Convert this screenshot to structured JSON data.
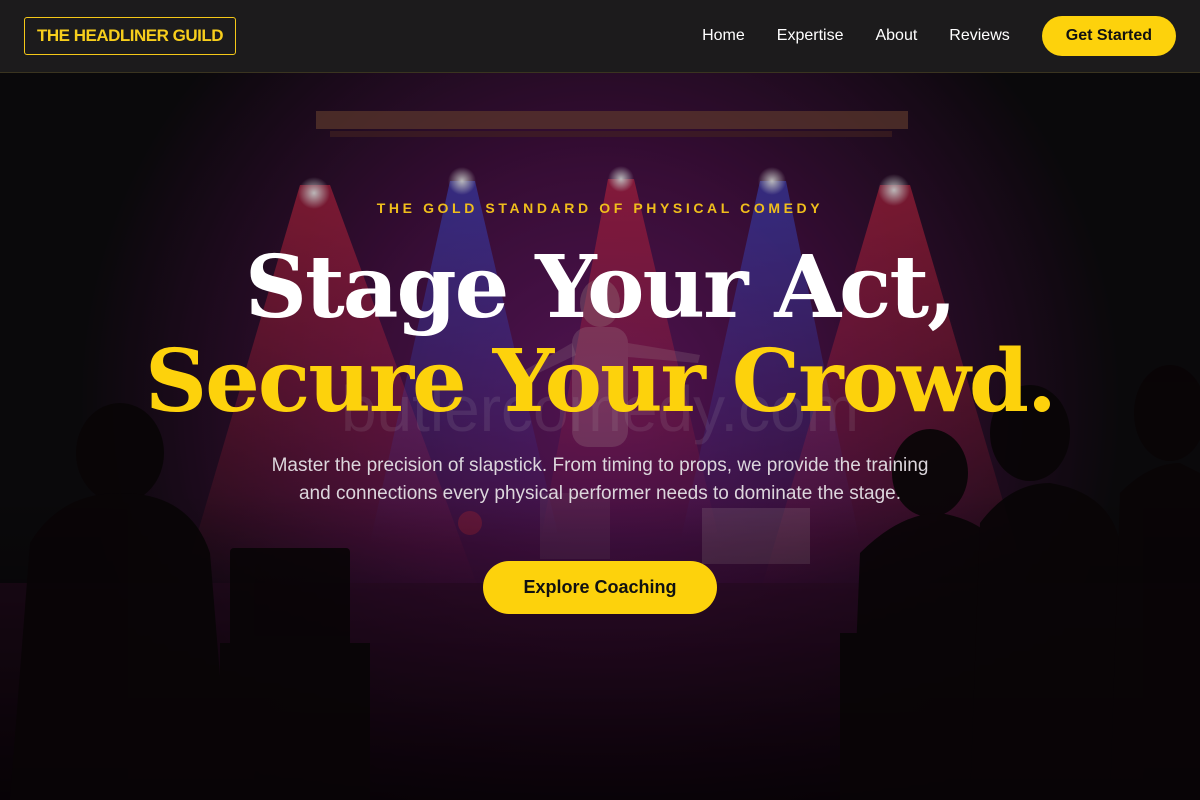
{
  "header": {
    "logo": "THE HEADLINER GUILD",
    "nav": [
      "Home",
      "Expertise",
      "About",
      "Reviews"
    ],
    "cta": "Get Started"
  },
  "hero": {
    "eyebrow": "THE GOLD STANDARD OF PHYSICAL COMEDY",
    "headline_line1": "Stage Your Act,",
    "headline_line2": "Secure Your Crowd.",
    "subtext": "Master the precision of slapstick. From timing to props, we provide the training and connections every physical performer needs to dominate the stage.",
    "button": "Explore Coaching",
    "background_watermark": "butlercomedy.com"
  },
  "colors": {
    "accent": "#fdd20c",
    "nav_background": "#1c1b1c",
    "page_background": "#0c0b0d"
  }
}
